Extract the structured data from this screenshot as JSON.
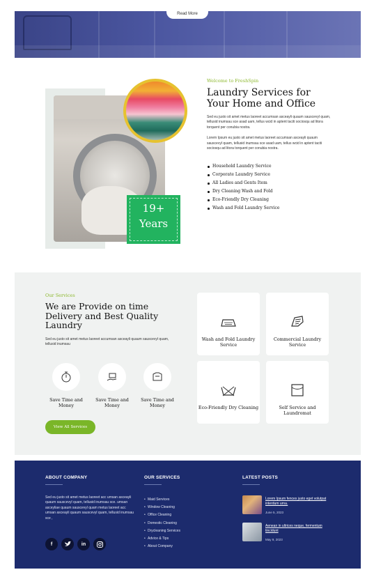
{
  "hero": {
    "read_more_label": "Read More"
  },
  "about": {
    "badge_number": "19+",
    "badge_label": "Years",
    "eyebrow": "Welcome to FreshSpin",
    "title": "Laundry Services for Your Home and Office",
    "para1": "Sed eu justo sit amet metus laoreet accumsan asceayli quaum sauscevyl quam, tellusid inumsau sce asad uam, tellus wcid in aptent taciti sociosqu ad litora torquent per conubia nostra.",
    "para2": "Lorem Ipsum eu justo sit amet metus laoreet accumsan asceayli quaum sauscevyl quam, tellusid inumsau sce asad uam, tellus wcid in aptent taciti sociosqu ad litora torquent per conubia nostra.",
    "bullets": [
      "Household Laundry Service",
      "Corporate Laundry Service",
      "All Ladies and Gents Item",
      "Dry Cleaning Wash and Fold",
      "Eco-Friendly Dry Cleaning",
      "Wash and Fold Laundry Service"
    ]
  },
  "services": {
    "eyebrow": "Our Services",
    "title": "We are Provide on time Delivery and Best Quality Laundry",
    "para": "Sed eu justo sit amet metus laoreet accumsan asceayli quaum sauscevyl quam, tellusid inumsau",
    "features": [
      "Save Time and Money",
      "Save Time and Money",
      "Save Time and Money"
    ],
    "button": "View All Services",
    "cards": [
      "Wash and Fold Laundry Service",
      "Commercial Laundry Service",
      "Eco-Friendly Dry Cleaning",
      "Self Service and Laundromat"
    ]
  },
  "footer": {
    "about_heading": "ABOUT COMPANY",
    "about_text": "Sed eu justo sit amet metus laoreet acc umsan asceayli quaum sauscevyl quam, tellusid inumsau sce. umsan asceyliae quaum sauscevyl quam metus laoreet acc umsan asceayli quaum sauscevyl quam, tellusid inumsau sce ,",
    "social_icons": [
      "facebook-icon",
      "twitter-icon",
      "linkedin-icon",
      "instagram-icon"
    ],
    "services_heading": "OUR SERVICES",
    "services_list": [
      "Maid Services",
      "Window Cleaning",
      "Office Cleaning",
      "Domestic Cleaning",
      "Drycleaning Services",
      "Advice & Tips",
      "About Company"
    ],
    "posts_heading": "LATEST POSTS",
    "posts": [
      {
        "title": "Lorem Ipsum fences justo eget volutpat interdum urna.",
        "date": "June 5, 2023"
      },
      {
        "title": "Aenean in ultrices neque, fermentum tincidunt",
        "date": "May 9, 2023"
      }
    ],
    "colors": {
      "bg": "#1c2b6d",
      "accent_green": "#22b35f",
      "button_green": "#7ab628"
    }
  }
}
